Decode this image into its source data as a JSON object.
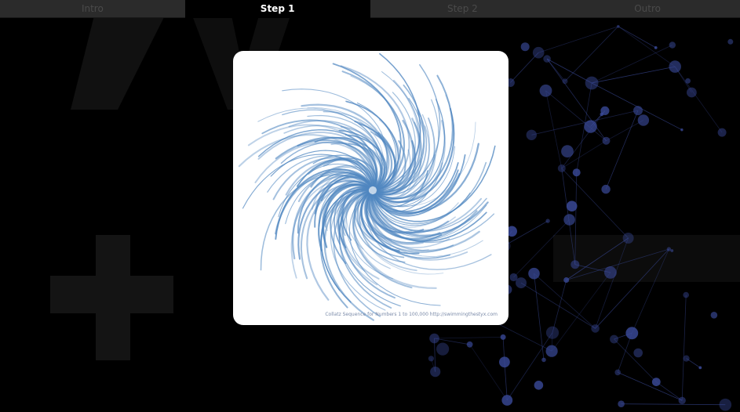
{
  "tabs": [
    {
      "label": "Intro",
      "active": false
    },
    {
      "label": "Step 1",
      "active": true
    },
    {
      "label": "Step 2",
      "active": false
    },
    {
      "label": "Outro",
      "active": false
    }
  ],
  "card": {
    "caption": "Collatz Sequence for Numbers 1 to 100,000 http://swimmingthestyx.com"
  },
  "colors": {
    "spiral": "#4f86c0",
    "network": "#3a4a9a",
    "tab_bg": "#2b2b2b",
    "tab_active_bg": "#000000"
  },
  "icons": {
    "spiral": "collatz-spiral-image",
    "background": "network-graph"
  }
}
